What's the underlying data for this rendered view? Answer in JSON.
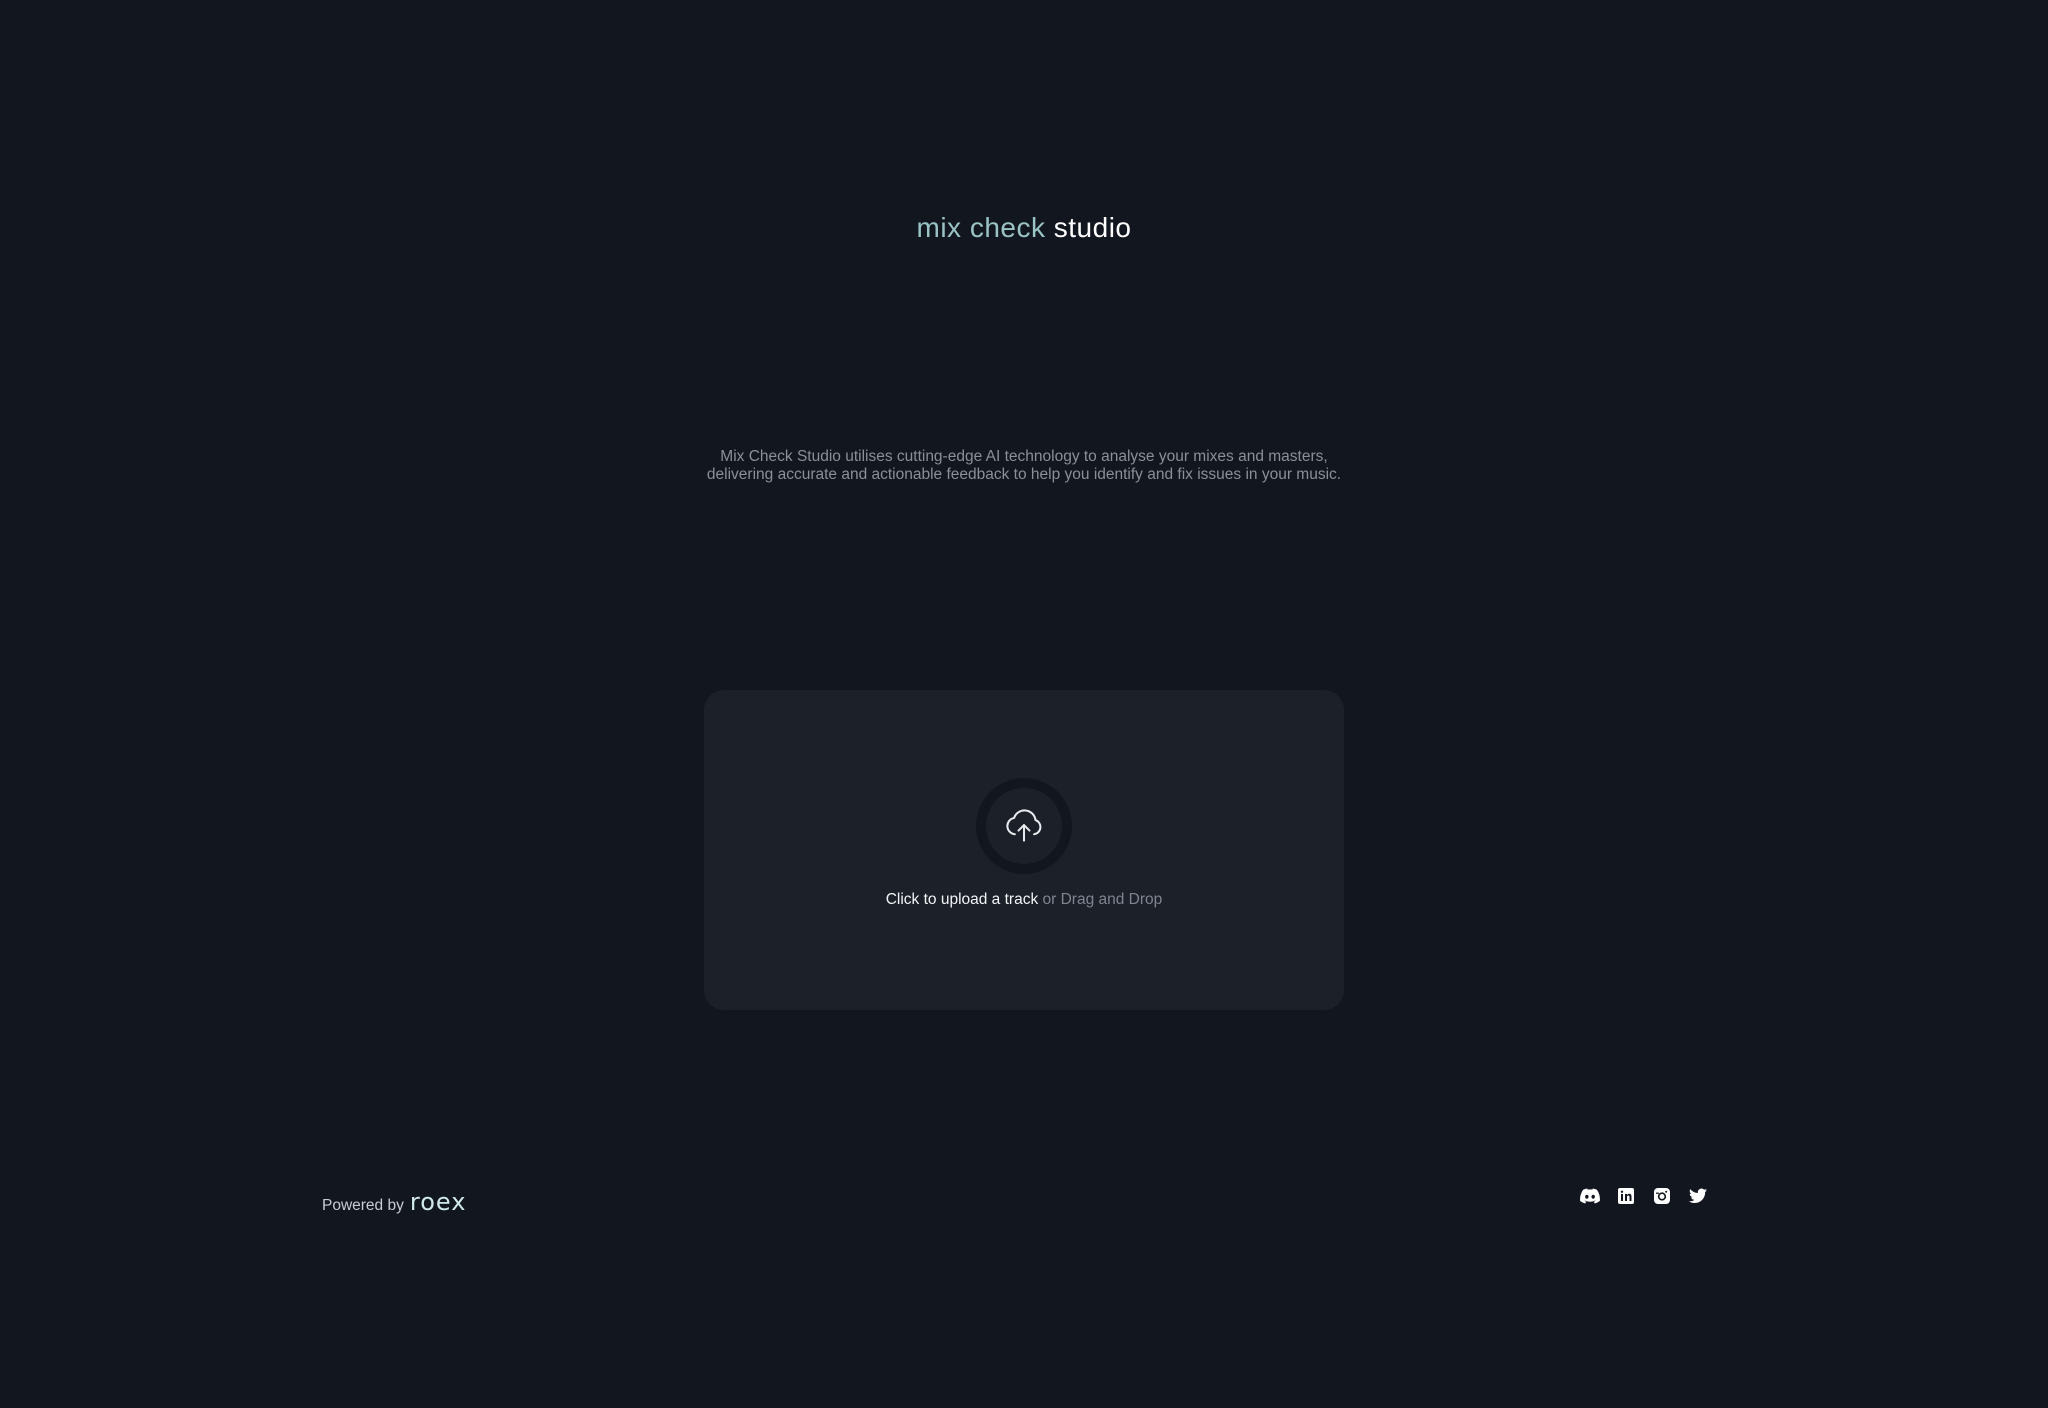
{
  "header": {
    "logo_part1": "mix check",
    "logo_part2": "studio"
  },
  "intro": {
    "description": "Mix Check Studio utilises cutting-edge AI technology to analyse your mixes and masters, delivering accurate and actionable feedback to help you identify and fix issues in your music."
  },
  "upload": {
    "icon": "cloud-upload-icon",
    "primary_label": "Click to upload a track",
    "secondary_label": "or Drag and Drop"
  },
  "footer": {
    "powered_by": "Powered by",
    "brand": "roex",
    "socials": [
      {
        "name": "Discord",
        "icon": "discord-icon"
      },
      {
        "name": "LinkedIn",
        "icon": "linkedin-icon"
      },
      {
        "name": "Instagram",
        "icon": "instagram-icon"
      },
      {
        "name": "Twitter",
        "icon": "twitter-icon"
      }
    ]
  },
  "colors": {
    "background": "#12161e",
    "card": "#1c2029",
    "logo_accent": "#a9d6d8"
  }
}
